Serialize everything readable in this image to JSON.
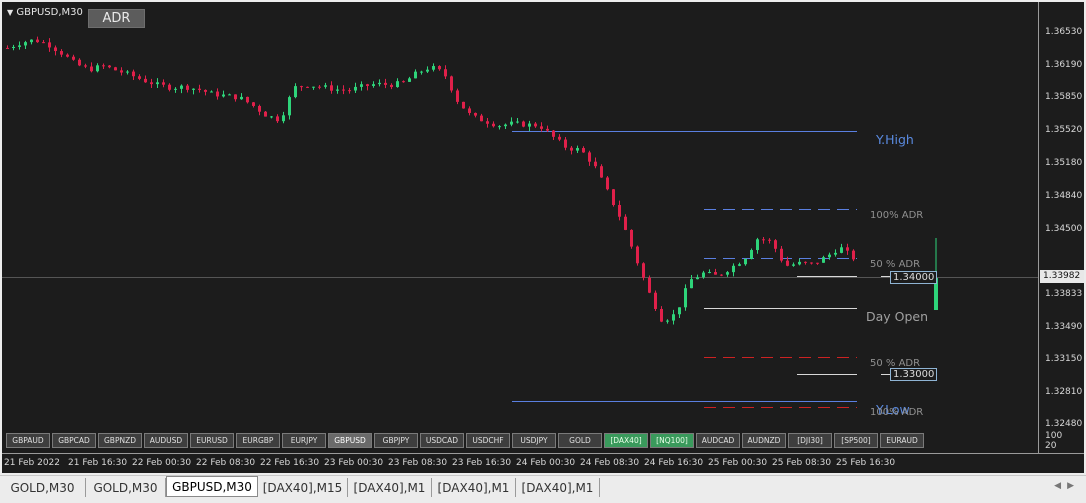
{
  "window": {
    "title": "GBPUSD,M30",
    "adr_button": "ADR"
  },
  "price_axis": {
    "labels": [
      "1.36530",
      "1.36190",
      "1.35850",
      "1.35520",
      "1.35180",
      "1.34840",
      "1.34500",
      "1.33833",
      "1.33490",
      "1.33150",
      "1.32810",
      "1.32480"
    ],
    "current_price": "1.33982",
    "sub_labels": [
      "100",
      "20"
    ]
  },
  "levels": {
    "y_high": "Y.High",
    "adr_100_upper": "100% ADR",
    "adr_50_upper": "50 % ADR",
    "day_open": "Day Open",
    "adr_50_lower": "50 % ADR",
    "y_low": "Y.Low",
    "adr_100_lower": "100% ADR",
    "price_box_upper": "1.34000",
    "price_box_lower": "1.33000"
  },
  "colors": {
    "bull": "#2ed47a",
    "bear": "#e0204a",
    "level_blue": "#6688dd",
    "level_red": "#cc2222",
    "bg": "#1c1c1c"
  },
  "time_axis": [
    "21 Feb 2022",
    "21 Feb 16:30",
    "22 Feb 00:30",
    "22 Feb 08:30",
    "22 Feb 16:30",
    "23 Feb 00:30",
    "23 Feb 08:30",
    "23 Feb 16:30",
    "24 Feb 00:30",
    "24 Feb 08:30",
    "24 Feb 16:30",
    "25 Feb 00:30",
    "25 Feb 08:30",
    "25 Feb 16:30"
  ],
  "symbols": [
    {
      "label": "GBPAUD",
      "state": "normal"
    },
    {
      "label": "GBPCAD",
      "state": "normal"
    },
    {
      "label": "GBPNZD",
      "state": "normal"
    },
    {
      "label": "AUDUSD",
      "state": "normal"
    },
    {
      "label": "EURUSD",
      "state": "normal"
    },
    {
      "label": "EURGBP",
      "state": "normal"
    },
    {
      "label": "EURJPY",
      "state": "normal"
    },
    {
      "label": "GBPUSD",
      "state": "active"
    },
    {
      "label": "GBPJPY",
      "state": "normal"
    },
    {
      "label": "USDCAD",
      "state": "normal"
    },
    {
      "label": "USDCHF",
      "state": "normal"
    },
    {
      "label": "USDJPY",
      "state": "normal"
    },
    {
      "label": "GOLD",
      "state": "normal"
    },
    {
      "label": "[DAX40]",
      "state": "green"
    },
    {
      "label": "[NQ100]",
      "state": "green"
    },
    {
      "label": "AUDCAD",
      "state": "normal"
    },
    {
      "label": "AUDNZD",
      "state": "normal"
    },
    {
      "label": "[DJI30]",
      "state": "normal"
    },
    {
      "label": "[SP500]",
      "state": "normal"
    },
    {
      "label": "EURAUD",
      "state": "normal"
    }
  ],
  "tabs": [
    {
      "label": "GOLD,M30",
      "active": false
    },
    {
      "label": "GOLD,M30",
      "active": false
    },
    {
      "label": "GBPUSD,M30",
      "active": true
    },
    {
      "label": "[DAX40],M15",
      "active": false
    },
    {
      "label": "[DAX40],M1",
      "active": false
    },
    {
      "label": "[DAX40],M1",
      "active": false
    },
    {
      "label": "[DAX40],M1",
      "active": false
    }
  ],
  "price_path": [
    1.3632,
    1.3638,
    1.3641,
    1.3636,
    1.3626,
    1.3614,
    1.3608,
    1.3612,
    1.3607,
    1.3602,
    1.3596,
    1.3591,
    1.3588,
    1.3589,
    1.3586,
    1.3581,
    1.3579,
    1.3577,
    1.3568,
    1.3557,
    1.3552,
    1.3588,
    1.3591,
    1.3589,
    1.3586,
    1.3585,
    1.3589,
    1.3592,
    1.3591,
    1.3593,
    1.3604,
    1.3611,
    1.3604,
    1.3573,
    1.3556,
    1.3551,
    1.3546,
    1.3548,
    1.3547,
    1.3546,
    1.3533,
    1.3521,
    1.3519,
    1.3502,
    1.3472,
    1.3441,
    1.3401,
    1.3361,
    1.3329,
    1.3337,
    1.3374,
    1.3382,
    1.3379,
    1.3388,
    1.3398,
    1.3421,
    1.3417,
    1.339,
    1.3393,
    1.3392,
    1.34,
    1.3411,
    1.3399
  ]
}
